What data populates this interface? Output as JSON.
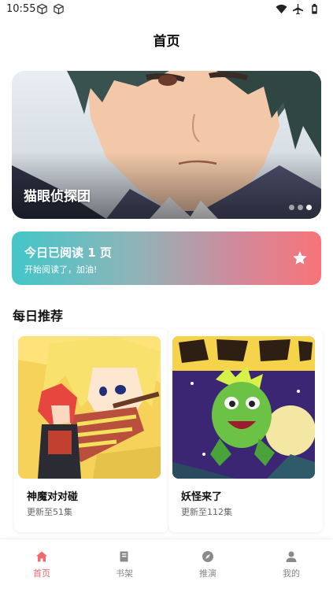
{
  "status_bar": {
    "time": "10:55",
    "left_icons": [
      "cube-icon",
      "cube-icon"
    ],
    "right_icons": [
      "wifi-icon",
      "airplane-icon",
      "battery-icon"
    ]
  },
  "header": {
    "title": "首页"
  },
  "banner": {
    "title": "猫眼侦探团",
    "dots_count": 3,
    "active_dot_index": 2
  },
  "reading_card": {
    "title": "今日已阅读 1 页",
    "subtitle": "开始阅读了，加油!",
    "icon": "star-icon"
  },
  "daily_recommend": {
    "title": "每日推荐",
    "items": [
      {
        "title": "神魔对对碰",
        "subtitle": "更新至51集"
      },
      {
        "title": "妖怪来了",
        "subtitle": "更新至112集"
      }
    ]
  },
  "bottom_nav": {
    "items": [
      {
        "label": "首页",
        "icon": "home-icon",
        "active": true
      },
      {
        "label": "书架",
        "icon": "book-icon",
        "active": false
      },
      {
        "label": "推演",
        "icon": "compass-icon",
        "active": false
      },
      {
        "label": "我的",
        "icon": "user-icon",
        "active": false
      }
    ],
    "active_color": "#f0696d",
    "inactive_color": "#8a8a8a"
  },
  "colors": {
    "gradient_start": "#43c6c9",
    "gradient_end": "#f77477"
  }
}
